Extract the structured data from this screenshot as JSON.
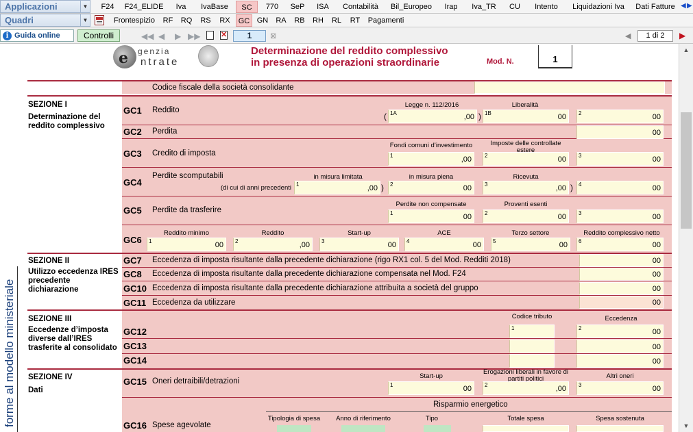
{
  "toolbar": {
    "applicazioni_label": "Applicazioni",
    "quadri_label": "Quadri",
    "tabs_row1": [
      "F24",
      "F24_ELIDE",
      "Iva",
      "IvaBase",
      "SC",
      "770",
      "SeP",
      "ISA",
      "Contabilità",
      "Bil_Europeo",
      "Irap",
      "Iva_TR",
      "CU",
      "Intento",
      "Liquidazioni Iva",
      "Dati Fatture"
    ],
    "active_row1": "SC",
    "tabs_row2": [
      "Frontespizio",
      "RF",
      "RQ",
      "RS",
      "RX",
      "GC",
      "GN",
      "RA",
      "RB",
      "RH",
      "RL",
      "RT",
      "Pagamenti"
    ],
    "active_row2": "GC",
    "guida_label": "Guida online",
    "controlli_label": "Controlli",
    "page_current": "1",
    "page_of": "1 di 2"
  },
  "form": {
    "logo_top": "genzia",
    "logo_bottom": "ntrate",
    "title_line1": "Determinazione del reddito complessivo",
    "title_line2": "in presenza di operazioni straordinarie",
    "mod_n_label": "Mod. N.",
    "mod_n_value": "1",
    "side_text": "forme al modello ministeriale",
    "cf_label": "Codice fiscale della società consolidante",
    "sez1_title": "SEZIONE I",
    "sez1_sub": "Determinazione del reddito complessivo",
    "sez2_title": "SEZIONE II",
    "sez2_sub": "Utilizzo eccedenza IRES precedente dichiarazione",
    "sez3_title": "SEZIONE III",
    "sez3_sub": "Eccedenze d’imposta diverse dall’IRES trasferite al consolidato",
    "sez4_title": "SEZIONE IV",
    "sez4_sub": "Dati",
    "gc1": "Reddito",
    "gc1_c1": "Legge n. 112/2016",
    "gc1_c2": "Liberalità",
    "gc2": "Perdita",
    "gc3": "Credito di imposta",
    "gc3_c1": "Fondi comuni d’investimento",
    "gc3_c2": "Imposte delle controllate estere",
    "gc4": "Perdite scomputabili",
    "gc4_sub": "(di cui di anni precedenti",
    "gc4_c1": "in misura limitata",
    "gc4_c2": "in misura piena",
    "gc4_c3": "Ricevuta",
    "gc5": "Perdite da trasferire",
    "gc5_c1": "Perdite non compensate",
    "gc5_c2": "Proventi esenti",
    "gc6_c1": "Reddito minimo",
    "gc6_c2": "Reddito",
    "gc6_c3": "Start-up",
    "gc6_c4": "ACE",
    "gc6_c5": "Terzo settore",
    "gc6_c6": "Reddito complessivo netto",
    "gc7": "Eccedenza di imposta risultante dalla precedente dichiarazione (rigo RX1 col. 5 del Mod. Redditi 2018)",
    "gc8": "Eccedenza di imposta risultante dalla precedente dichiarazione compensata nel Mod. F24",
    "gc10": "Eccedenza di imposta risultante dalla precedente dichiarazione attribuita a società del gruppo",
    "gc11": "Eccedenza da utilizzare",
    "gc12_c1": "Codice tributo",
    "gc12_c2": "Eccedenza",
    "gc15": "Oneri detraibili/detrazioni",
    "gc15_c1": "Start-up",
    "gc15_c2": "Erogazioni liberali in favore di partiti politici",
    "gc15_c3": "Altri oneri",
    "risparmio": "Risparmio energetico",
    "gc16": "Spese agevolate",
    "gc16_c1": "Tipologia di spesa",
    "gc16_c2": "Anno di riferimento",
    "gc16_c3": "Tipo",
    "gc16_c4": "Totale spesa",
    "gc16_c5": "Spesa sostenuta",
    "zero": "00",
    "zero_dec": ",00"
  }
}
